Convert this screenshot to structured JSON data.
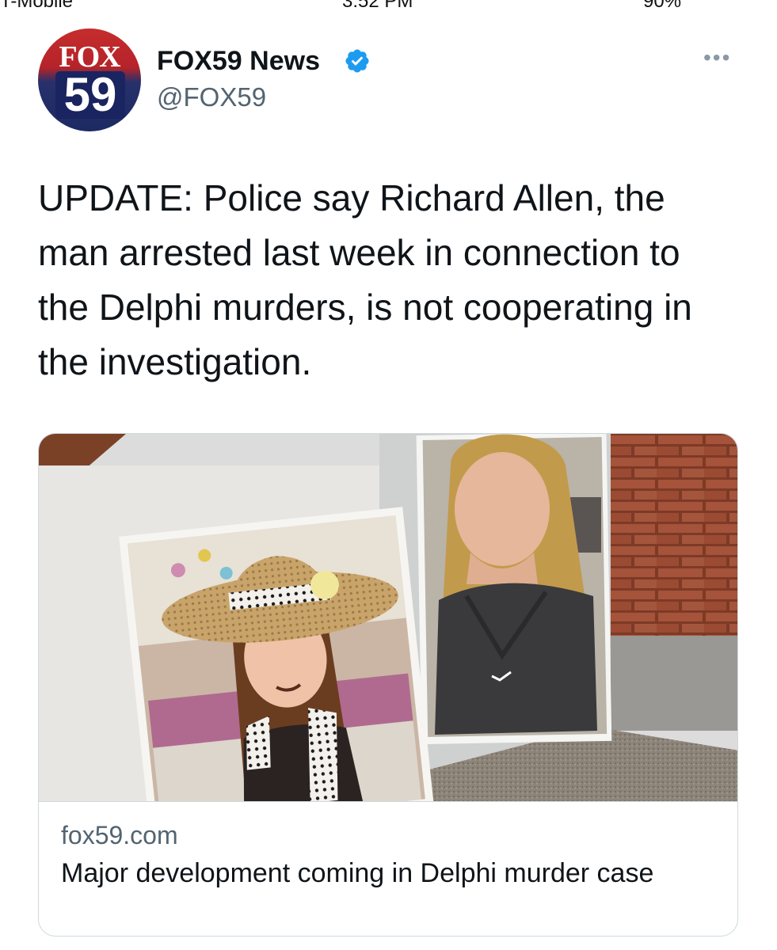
{
  "status_bar": {
    "carrier": "T-Mobile",
    "time": "3:52 PM",
    "battery": "90%"
  },
  "tweet": {
    "display_name": "FOX59 News",
    "handle": "@FOX59",
    "verified": true,
    "avatar_text_top": "FOX",
    "avatar_text_bottom": "59",
    "more_label": "•••",
    "text": "UPDATE: Police say Richard Allen, the man arrested last week in connection to the Delphi murders, is not cooperating in the investigation.",
    "card": {
      "domain": "fox59.com",
      "title": "Major development coming in Delphi murder case"
    }
  },
  "colors": {
    "verified_blue": "#1d9bf0",
    "secondary_text": "#536471",
    "border": "#cfd9de"
  }
}
